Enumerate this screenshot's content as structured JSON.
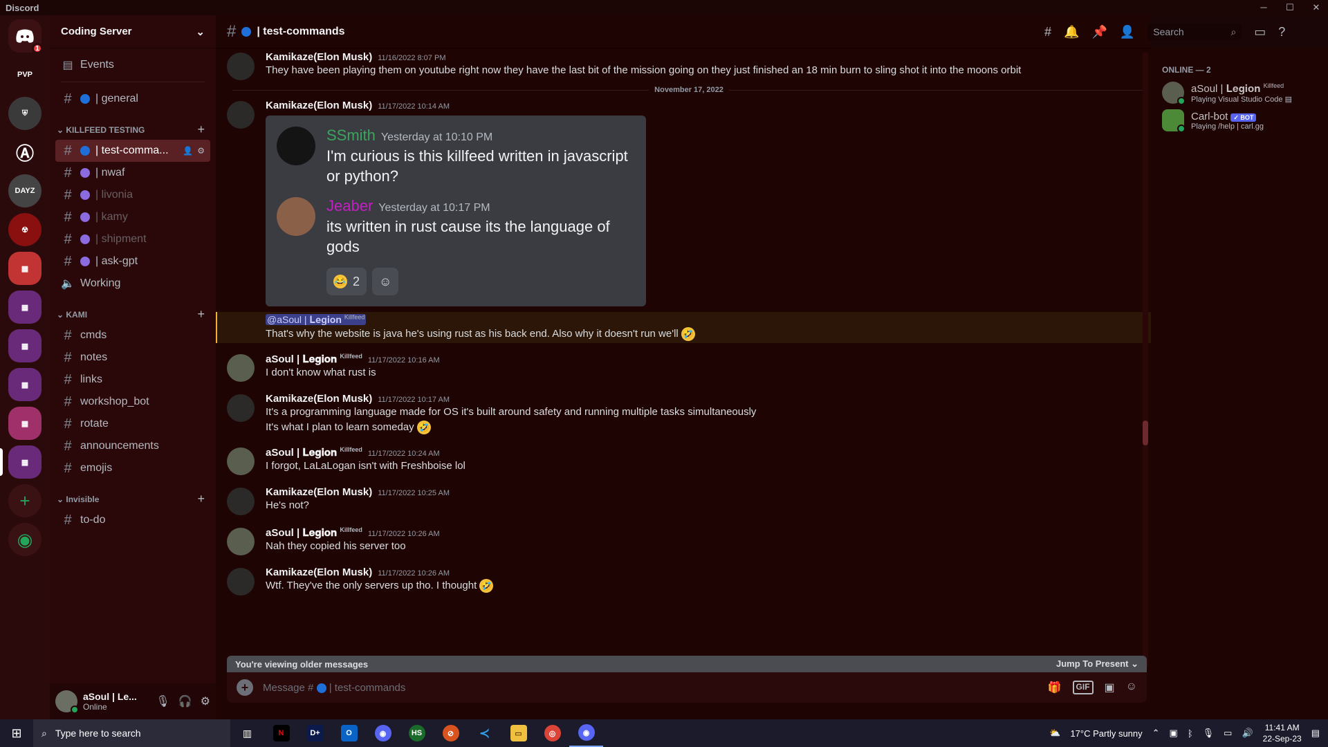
{
  "window": {
    "title": "Discord"
  },
  "rail": {
    "home_badge": "1"
  },
  "server": {
    "name": "Coding Server",
    "events_label": "Events",
    "top_channels": [
      {
        "name": "| general"
      }
    ],
    "categories": [
      {
        "name": "KILLFEED TESTING",
        "channels": [
          {
            "name": "| test-comma...",
            "active": true
          },
          {
            "name": "| nwaf"
          },
          {
            "name": "| livonia",
            "muted": true
          },
          {
            "name": "| kamy",
            "muted": true
          },
          {
            "name": "| shipment",
            "muted": true
          },
          {
            "name": "| ask-gpt"
          }
        ],
        "voice": "Working"
      },
      {
        "name": "KAMI",
        "channels": [
          {
            "name": "cmds"
          },
          {
            "name": "notes"
          },
          {
            "name": "links"
          },
          {
            "name": "workshop_bot"
          },
          {
            "name": "rotate"
          },
          {
            "name": "announcements"
          },
          {
            "name": "emojis"
          }
        ]
      },
      {
        "name": "Invisible",
        "channels": [
          {
            "name": "to-do"
          }
        ]
      }
    ]
  },
  "user_panel": {
    "name": "aSoul | Le...",
    "status": "Online"
  },
  "channel_header": {
    "name": "| test-commands",
    "search_placeholder": "Search"
  },
  "messages": {
    "m1": {
      "author": "Kamikaze(Elon Musk)",
      "ts": "11/16/2022 8:07 PM",
      "text": "They have been playing them on youtube right now they have the last bit of the mission going on they just finished an 18 min burn to sling shot it into the moons orbit"
    },
    "date_divider": "November 17, 2022",
    "m2": {
      "author": "Kamikaze(Elon Musk)",
      "ts": "11/17/2022 10:14 AM"
    },
    "embed": {
      "q1": {
        "author": "SSmith",
        "author_color": "#3ba55c",
        "ts": "Yesterday at 10:10 PM",
        "text": "I'm curious is this killfeed written in javascript or python?"
      },
      "q2": {
        "author": "Jeaber",
        "author_color": "#c41fc4",
        "ts": "Yesterday at 10:17 PM",
        "text": "its written in rust cause its the language of gods"
      },
      "reaction_count": "2"
    },
    "m3": {
      "mention": "@aSoul | 𝐋𝐞𝐠𝐢𝐨𝐧",
      "mention_tag": "Killfeed",
      "text": "That's why the website is java he's using rust as his back end. Also why it doesn't run we'll"
    },
    "m4": {
      "author": "aSoul | 𝐋𝐞𝐠𝐢𝐨𝐧",
      "tag": "Killfeed",
      "ts": "11/17/2022 10:16 AM",
      "text": "I don't know what rust is"
    },
    "m5": {
      "author": "Kamikaze(Elon Musk)",
      "ts": "11/17/2022 10:17 AM",
      "text": "It's a programming language made for OS it's built around safety and running multiple tasks simultaneously",
      "text2": "It's what I plan to learn someday"
    },
    "m6": {
      "author": "aSoul | 𝐋𝐞𝐠𝐢𝐨𝐧",
      "tag": "Killfeed",
      "ts": "11/17/2022 10:24 AM",
      "text": "I forgot, LaLaLogan isn't with Freshboise lol"
    },
    "m7": {
      "author": "Kamikaze(Elon Musk)",
      "ts": "11/17/2022 10:25 AM",
      "text": "He's not?"
    },
    "m8": {
      "author": "aSoul | 𝐋𝐞𝐠𝐢𝐨𝐧",
      "tag": "Killfeed",
      "ts": "11/17/2022 10:26 AM",
      "text": "Nah they copied his server too"
    },
    "m9": {
      "author": "Kamikaze(Elon Musk)",
      "ts": "11/17/2022 10:26 AM",
      "text": "Wtf. They've the only servers up tho. I thought"
    }
  },
  "older_bar": {
    "text": "You're viewing older messages",
    "jump": "Jump To Present"
  },
  "composer": {
    "prefix": "Message #",
    "channel": "| test-commands",
    "gif": "GIF"
  },
  "members": {
    "category": "ONLINE — 2",
    "list": [
      {
        "name": "aSoul | 𝐋𝐞𝐠𝐢𝐨𝐧",
        "tag": "Killfeed",
        "activity": "Playing Visual Studio Code"
      },
      {
        "name": "Carl-bot",
        "bot": "✓ BOT",
        "activity": "Playing /help | carl.gg"
      }
    ]
  },
  "taskbar": {
    "search": "Type here to search",
    "weather": "17°C  Partly sunny",
    "time": "11:41 AM",
    "date": "22-Sep-23"
  }
}
